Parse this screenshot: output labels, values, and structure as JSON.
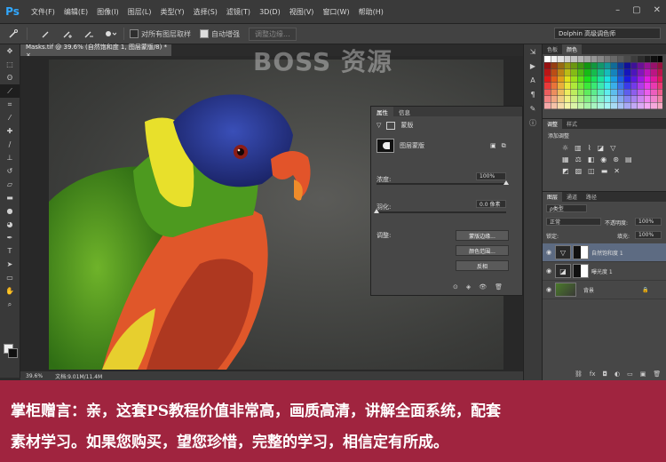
{
  "menubar": {
    "logo": "Ps",
    "items": [
      "文件(F)",
      "编辑(E)",
      "图像(I)",
      "图层(L)",
      "类型(Y)",
      "选择(S)",
      "滤镜(T)",
      "3D(D)",
      "视图(V)",
      "窗口(W)",
      "帮助(H)"
    ],
    "controls": [
      "–",
      "▢",
      "✕"
    ]
  },
  "options": {
    "sample_all_label": "对所有图层取样",
    "auto_enhance_label": "自动增强",
    "refine_edge_label": "调整边缘...",
    "workspace": "Dolphin 高级调色师"
  },
  "document": {
    "tab": "Masks.tif @ 39.6% (自然饱和度 1, 图层蒙版/8) * ×",
    "zoom": "39.6%",
    "doc_info": "文档:9.01M/11.4M"
  },
  "watermark": "BOSS 资源",
  "properties": {
    "tabs": [
      "属性",
      "信息"
    ],
    "title": "蒙版",
    "mask_label": "图层蒙版",
    "density_label": "浓度:",
    "density_value": "100%",
    "density_level": 1.0,
    "feather_label": "羽化:",
    "feather_value": "0.0 像素",
    "feather_level": 0.0,
    "refine_label": "调整:",
    "buttons": [
      "蒙版边缘...",
      "颜色范围...",
      "反相"
    ]
  },
  "swatches_panel": {
    "tabs": [
      "色板",
      "颜色"
    ]
  },
  "adjustments_panel": {
    "tabs": [
      "调整",
      "样式"
    ],
    "title": "添加调整"
  },
  "layers_panel": {
    "tabs": [
      "图层",
      "通道",
      "路径"
    ],
    "kind": "ρ类型",
    "blend_mode": "正常",
    "opacity_label": "不透明度:",
    "opacity": "100%",
    "lock_label": "锁定:",
    "fill_label": "填充:",
    "fill": "100%",
    "layers": [
      {
        "name": "自然饱和度 1",
        "selected": true
      },
      {
        "name": "曝光度 1",
        "selected": false
      },
      {
        "name": "背景",
        "selected": false
      }
    ]
  },
  "banner": {
    "line1": "掌柜赠言：亲，这套PS教程价值非常高，画质高清，讲解全面系统，配套",
    "line2": "素材学习。如果您购买，望您珍惜，完整的学习，相信定有所成。",
    "color": "#a0243f"
  }
}
